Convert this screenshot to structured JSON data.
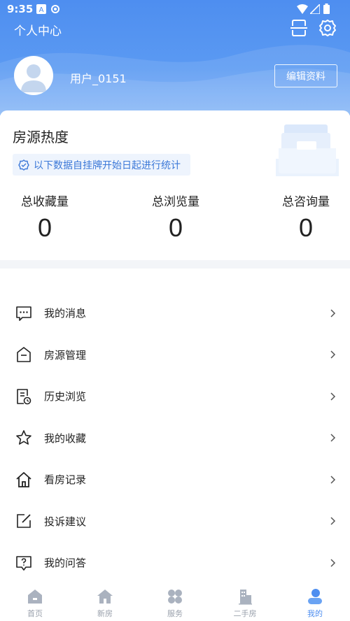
{
  "statusbar": {
    "time": "9:35"
  },
  "header": {
    "title": "个人中心",
    "username": "用户_0151",
    "edit_label": "编辑资料",
    "accent_color": "#4e8ef0"
  },
  "heat": {
    "title": "房源热度",
    "note": "以下数据自挂牌开始日起进行统计",
    "stats": [
      {
        "label": "总收藏量",
        "value": "0"
      },
      {
        "label": "总浏览量",
        "value": "0"
      },
      {
        "label": "总咨询量",
        "value": "0"
      }
    ]
  },
  "menu": {
    "items": [
      {
        "label": "我的消息",
        "icon": "message-icon"
      },
      {
        "label": "房源管理",
        "icon": "house-manage-icon"
      },
      {
        "label": "历史浏览",
        "icon": "history-icon"
      },
      {
        "label": "我的收藏",
        "icon": "star-icon"
      },
      {
        "label": "看房记录",
        "icon": "home-icon"
      },
      {
        "label": "投诉建议",
        "icon": "edit-icon"
      },
      {
        "label": "我的问答",
        "icon": "question-icon"
      }
    ]
  },
  "bottomnav": {
    "items": [
      {
        "label": "首页",
        "icon": "home-nav-icon",
        "active": false
      },
      {
        "label": "新房",
        "icon": "new-house-icon",
        "active": false
      },
      {
        "label": "服务",
        "icon": "service-icon",
        "active": false
      },
      {
        "label": "二手房",
        "icon": "second-hand-icon",
        "active": false
      },
      {
        "label": "我的",
        "icon": "profile-icon",
        "active": true
      }
    ]
  }
}
